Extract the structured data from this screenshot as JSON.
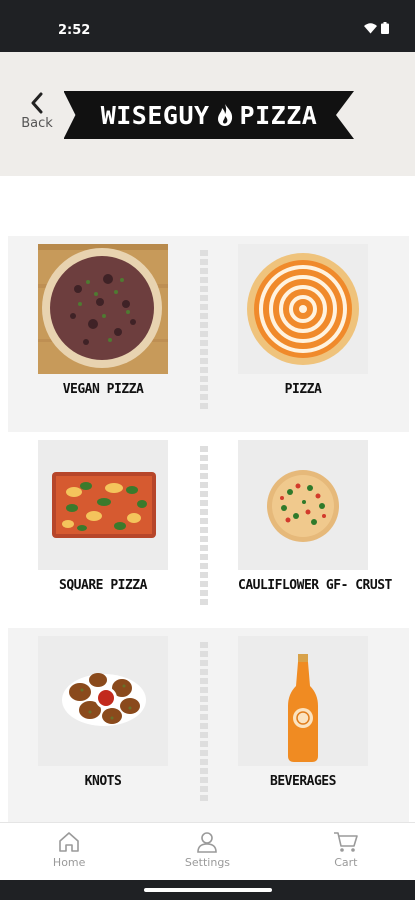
{
  "status_bar": {
    "time": "2:52"
  },
  "header": {
    "back_label": "Back",
    "logo_left": "WISEGUY",
    "logo_right": "PIZZA",
    "logo_bg": "#111111",
    "bg_color": "#efedea"
  },
  "categories": [
    {
      "label": "VEGAN PIZZA",
      "image": "vegan-pizza"
    },
    {
      "label": "PIZZA",
      "image": "white-pizza"
    },
    {
      "label": "SQUARE PIZZA",
      "image": "square-pizza"
    },
    {
      "label": "CAULIFLOWER GF- CRUST",
      "image": "cauliflower-pizza"
    },
    {
      "label": "KNOTS",
      "image": "garlic-knots"
    },
    {
      "label": "BEVERAGES",
      "image": "orange-soda-bottle"
    }
  ],
  "bottom_nav": {
    "items": [
      {
        "label": "Home",
        "icon": "home-icon"
      },
      {
        "label": "Settings",
        "icon": "user-icon"
      },
      {
        "label": "Cart",
        "icon": "cart-icon"
      }
    ]
  }
}
